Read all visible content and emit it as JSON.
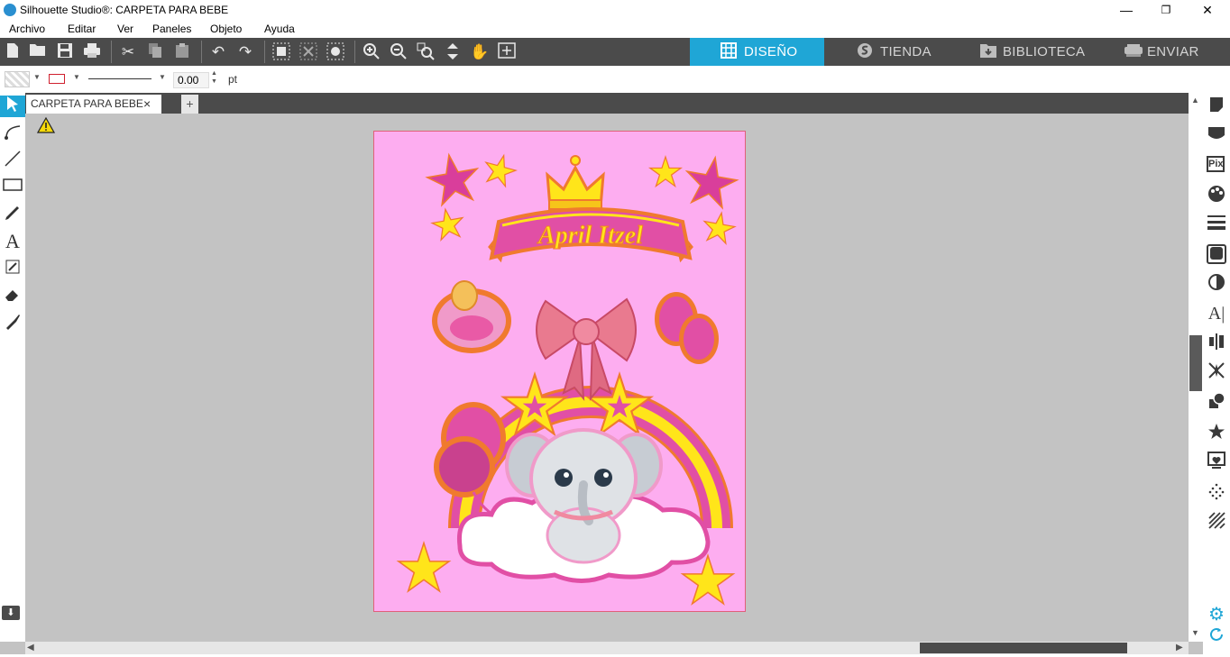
{
  "window": {
    "title": "Silhouette Studio®: CARPETA PARA BEBE",
    "minimize": "—",
    "maximize": "❐",
    "close": "✕"
  },
  "menu": [
    "Archivo",
    "Editar",
    "Ver",
    "Paneles",
    "Objeto",
    "Ayuda"
  ],
  "nav_tabs": [
    {
      "label": "DISEÑO",
      "icon": "grid-icon",
      "active": true
    },
    {
      "label": "TIENDA",
      "icon": "store-s-icon",
      "active": false
    },
    {
      "label": "BIBLIOTECA",
      "icon": "library-folder-icon",
      "active": false
    },
    {
      "label": "ENVIAR",
      "icon": "send-cutter-icon",
      "active": false
    }
  ],
  "properties": {
    "line_width_value": "0.00",
    "line_width_unit": "pt"
  },
  "document_tab": {
    "label": "CARPETA PARA BEBE",
    "close": "×",
    "add": "+"
  },
  "design": {
    "name_text": "April Itzel",
    "page_color": "#fdadf0"
  },
  "colors": {
    "accent": "#1fa6d6",
    "toolbar": "#4b4b4b",
    "canvas": "#c3c3c3"
  }
}
